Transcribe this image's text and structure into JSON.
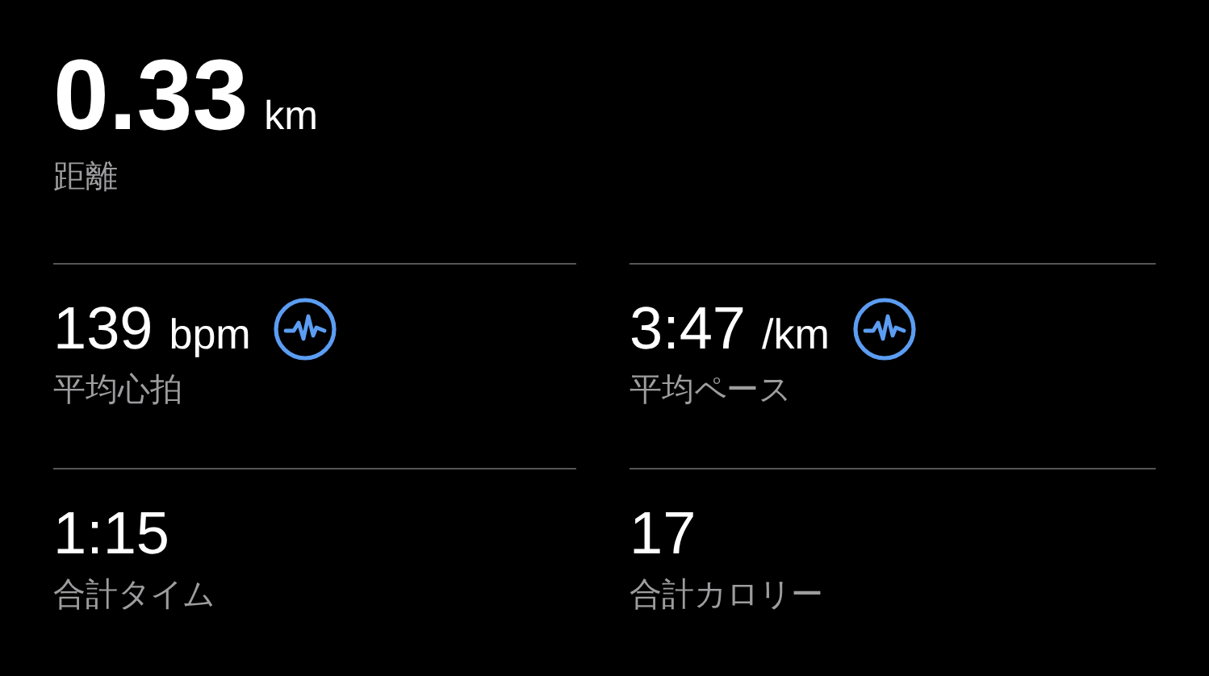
{
  "distance": {
    "value": "0.33",
    "unit": "km",
    "label": "距離"
  },
  "stats": [
    {
      "value": "139",
      "unit": "bpm",
      "label": "平均心拍",
      "trend_icon": true
    },
    {
      "value": "3:47",
      "unit": "/km",
      "label": "平均ペース",
      "trend_icon": true
    },
    {
      "value": "1:15",
      "label": "合計タイム",
      "trend_icon": false
    },
    {
      "value": "17",
      "label": "合計カロリー",
      "trend_icon": false
    }
  ]
}
